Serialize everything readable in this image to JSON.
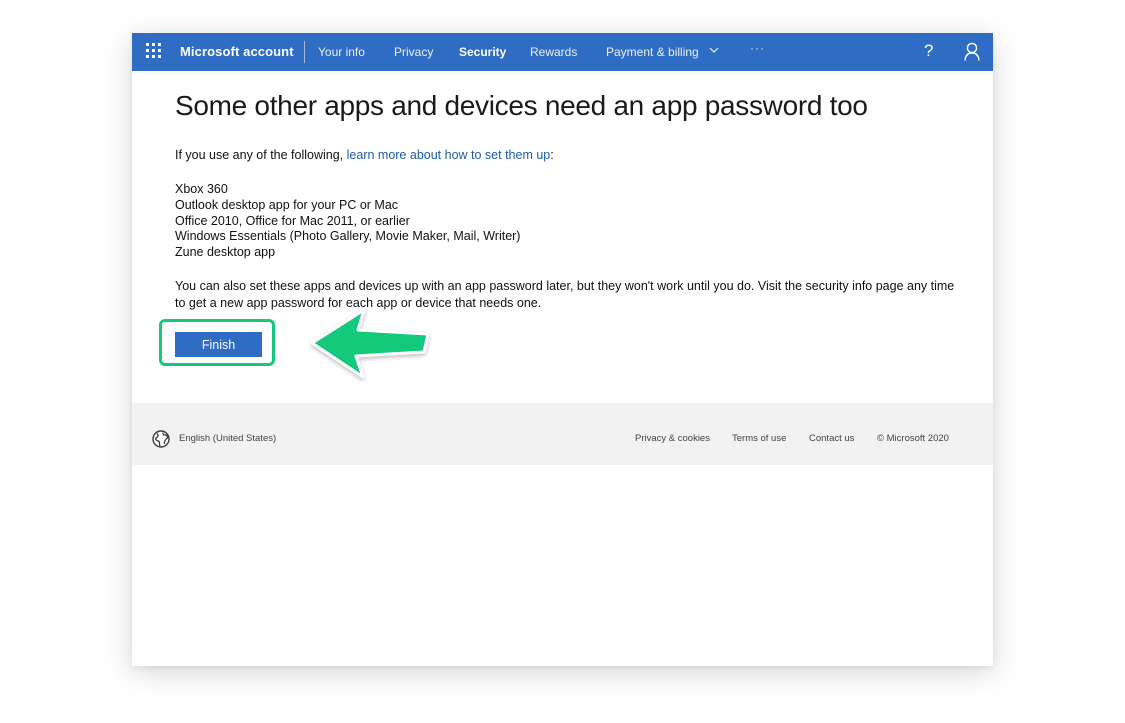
{
  "header": {
    "brand": "Microsoft account",
    "nav": [
      "Your info",
      "Privacy",
      "Security",
      "Rewards",
      "Payment & billing"
    ],
    "active_nav": "Security",
    "more": "···",
    "help": "?",
    "colors": {
      "bar": "#2f6cc3"
    }
  },
  "main": {
    "title": "Some other apps and devices need an app password too",
    "intro_prefix": "If you use any of the following, ",
    "intro_link": "learn more about how to set them up",
    "intro_suffix": ":",
    "apps": [
      "Xbox 360",
      "Outlook desktop app for your PC or Mac",
      "Office 2010, Office for Mac 2011, or earlier",
      "Windows Essentials (Photo Gallery, Movie Maker, Mail, Writer)",
      "Zune desktop app"
    ],
    "later_text": "You can also set these apps and devices up with an app password later, but they won't work until you do. Visit the security info page any time to get a new app password for each app or device that needs one.",
    "finish_label": "Finish",
    "highlight_color": "#14c87c"
  },
  "footer": {
    "locale": "English (United States)",
    "links": [
      "Privacy & cookies",
      "Terms of use",
      "Contact us"
    ],
    "copyright": "© Microsoft 2020"
  },
  "icons": [
    "waffle-icon",
    "chevron-down-icon",
    "help-icon",
    "user-icon",
    "globe-icon",
    "green-arrow-annotation"
  ]
}
